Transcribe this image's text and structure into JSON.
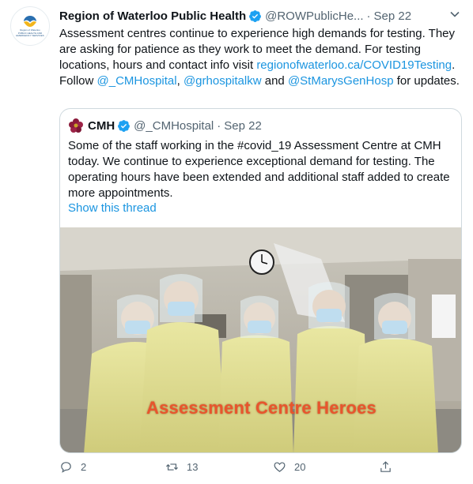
{
  "tweet": {
    "author_name": "Region of Waterloo Public Health",
    "handle": "@ROWPublicHe...",
    "separator": "·",
    "date": "Sep 22",
    "text_1": "Assessment centres continue to experience high demands for testing. They are asking for patience as they work to meet the demand. For testing locations, hours and contact info visit ",
    "link_url": "regionofwaterloo.ca/COVID19Testing",
    "text_2": ". Follow ",
    "mention_1": "@_CMHospital",
    "text_3": ", ",
    "mention_2": "@grhospitalkw",
    "text_4": " and ",
    "mention_3": "@StMarysGenHosp",
    "text_5": " for updates."
  },
  "quote": {
    "author_name": "CMH",
    "handle": "@_CMHospital",
    "separator": "·",
    "date": "Sep 22",
    "text": "Some of the staff working in the #covid_19 Assessment Centre at CMH today.  We continue to experience exceptional demand for testing. The operating hours have been extended and additional staff added to create more appointments.",
    "show_thread": "Show this thread",
    "image_caption": "Assessment Centre Heroes"
  },
  "actions": {
    "reply_count": "2",
    "retweet_count": "13",
    "like_count": "20"
  },
  "icons": {
    "verified": "verified-badge-icon",
    "more": "chevron-down-icon",
    "reply": "reply-icon",
    "retweet": "retweet-icon",
    "like": "heart-icon",
    "share": "share-icon"
  },
  "colors": {
    "link": "#1b95e0",
    "muted": "#536471",
    "text": "#0f1419",
    "caption": "#e8552d",
    "verified": "#1da1f2"
  }
}
